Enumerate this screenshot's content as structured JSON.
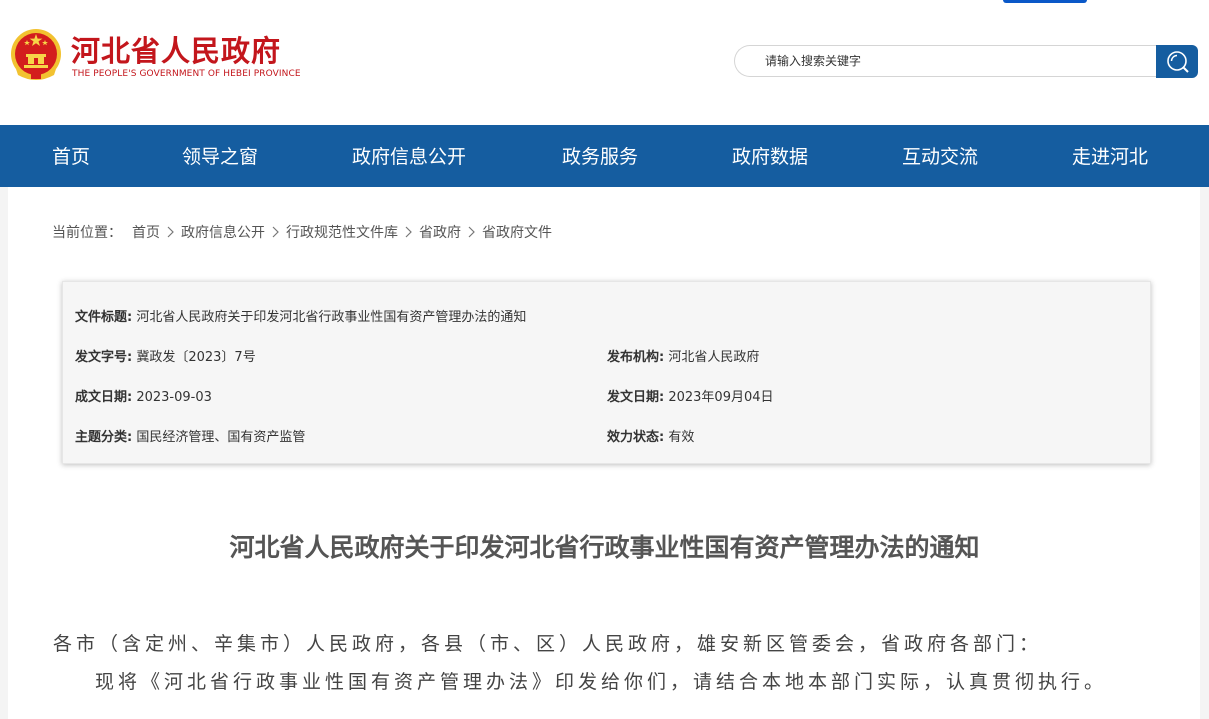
{
  "header": {
    "logo_cn": "河北省人民政府",
    "logo_en": "THE PEOPLE'S GOVERNMENT OF HEBEI PROVINCE",
    "search_placeholder": "请输入搜索关键字"
  },
  "colors": {
    "brand_red": "#c3161c",
    "nav_blue": "#155da0",
    "emblem_gold": "#f2c230"
  },
  "icons": {
    "emblem": "national-emblem-icon",
    "search": "search-icon",
    "breadcrumb_separator": "chevron-right-icon"
  },
  "nav": [
    "首页",
    "领导之窗",
    "政府信息公开",
    "政务服务",
    "政府数据",
    "互动交流",
    "走进河北"
  ],
  "breadcrumb": {
    "prefix": "当前位置：",
    "items": [
      "首页",
      "政府信息公开",
      "行政规范性文件库",
      "省政府",
      "省政府文件"
    ]
  },
  "doc_info": {
    "title_label": "文件标题:",
    "title": "河北省人民政府关于印发河北省行政事业性国有资产管理办法的通知",
    "doc_no_label": "发文字号:",
    "doc_no": "冀政发〔2023〕7号",
    "issuer_label": "发布机构:",
    "issuer": "河北省人民政府",
    "written_label": "成文日期:",
    "written": "2023-09-03",
    "issued_label": "发文日期:",
    "issued": "2023年09月04日",
    "category_label": "主题分类:",
    "category": "国民经济管理、国有资产监管",
    "status_label": "效力状态:",
    "status": "有效"
  },
  "article": {
    "title": "河北省人民政府关于印发河北省行政事业性国有资产管理办法的通知",
    "salutation": "各市（含定州、辛集市）人民政府，各县（市、区）人民政府，雄安新区管委会，省政府各部门：",
    "body": "现将《河北省行政事业性国有资产管理办法》印发给你们，请结合本地本部门实际，认真贯彻执行。"
  }
}
